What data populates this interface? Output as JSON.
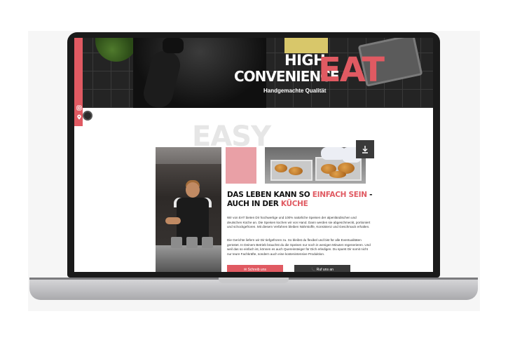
{
  "hero": {
    "line1": "HIGH",
    "line2": "CONVENIENCE",
    "brand": "EAT",
    "tagline": "Handgemachte Qualität"
  },
  "section": {
    "background_word": "EASY",
    "headline_part1": "DAS LEBEN KANN SO ",
    "headline_highlight1": "EINFACH SEIN",
    "headline_part2": " -",
    "headline_part3": "AUCH IN DER ",
    "headline_highlight2": "KÜCHE",
    "paragraph1": "Wir von EAT bieten Dir hochwertige und 100% natürliche Speisen der alpenländischen und deutschen Küche an. Die Speisen kochen wir von Hand. Dann werden sie abgeschmeckt, portioniert und schockgefroren. Mit diesem Verfahren bleiben Nährstoffe, Konsistenz und Geschmack erhalten.",
    "paragraph2": "Die Gerichte liefern wir Dir tiefgefroren zu. So bleibst du flexibel und bist für alle Eventualitäten gerüstet. In Deinem Betrieb brauchst du die Speisen nur noch in wenigen Minuten regenerieren. Und weil das so einfach ist, können es auch Quereinsteiger für Dich erledigen. Du sparst Dir somit nicht nur teure Fachkräfte, sondern auch eine kostenintensive Produktion.",
    "button_write": "✉ Schreib uns",
    "button_call": "📞 Ruf uns an"
  },
  "icons": {
    "download": "download-arrow-icon",
    "instagram": "instagram-icon",
    "location": "location-pin-icon"
  },
  "colors": {
    "accent": "#e05a62",
    "accent_light": "#e9a0a6",
    "dark": "#3a3a3a"
  }
}
